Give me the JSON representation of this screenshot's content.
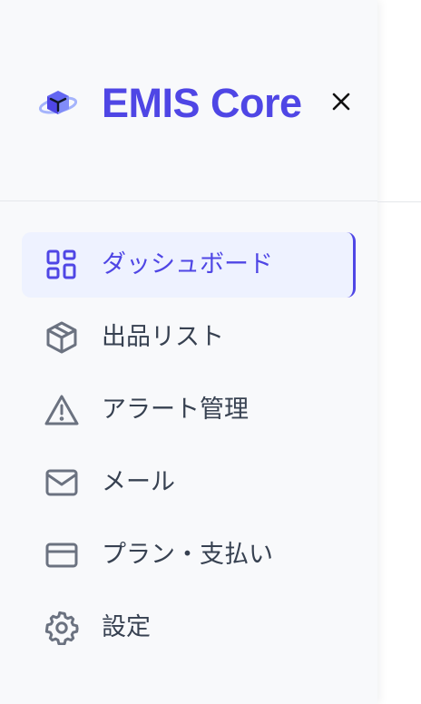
{
  "brand": {
    "title": "EMIS Core",
    "logo_icon": "cube-planet-logo-icon",
    "close_icon": "close-icon"
  },
  "colors": {
    "accent": "#4f46e5",
    "active_bg": "#eef2ff",
    "text": "#374151",
    "icon": "#6b7280",
    "sidebar_bg": "#f8f9fb"
  },
  "nav": {
    "items": [
      {
        "label": "ダッシュボード",
        "icon": "dashboard-grid-icon",
        "active": true
      },
      {
        "label": "出品リスト",
        "icon": "package-cube-icon",
        "active": false
      },
      {
        "label": "アラート管理",
        "icon": "warning-triangle-icon",
        "active": false
      },
      {
        "label": "メール",
        "icon": "mail-envelope-icon",
        "active": false
      },
      {
        "label": "プラン・支払い",
        "icon": "credit-card-icon",
        "active": false
      },
      {
        "label": "設定",
        "icon": "gear-icon",
        "active": false
      }
    ]
  }
}
